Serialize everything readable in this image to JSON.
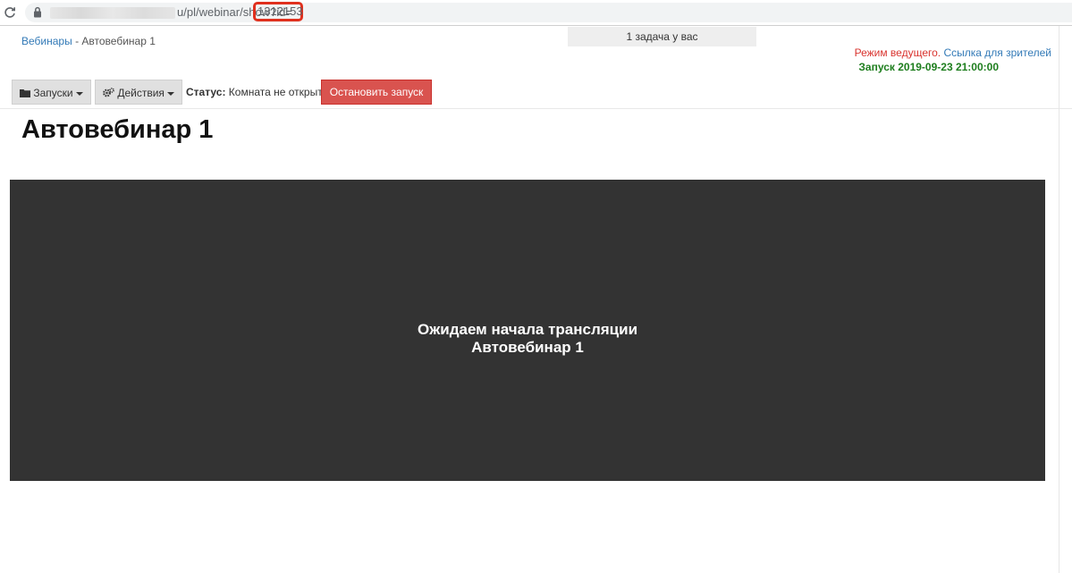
{
  "browser": {
    "url_path": "u/pl/webinar/show?id=",
    "url_id": "1312153",
    "icons": [
      "reload-icon",
      "lock-icon"
    ]
  },
  "breadcrumb": {
    "parent": "Вебинары",
    "separator": "-",
    "current": "Автовебинар 1"
  },
  "tasks": {
    "label": "1 задача у вас"
  },
  "mode": {
    "host_mode": "Режим ведущего.",
    "viewer_link": "Ссылка для зрителей",
    "launch": "Запуск 2019-09-23 21:00:00"
  },
  "toolbar": {
    "runs_label": "Запуски",
    "actions_label": "Действия",
    "status_label": "Статус:",
    "status_value": "Комната не открыта",
    "stop_label": "Остановить запуск"
  },
  "page": {
    "title": "Автовебинар 1"
  },
  "player": {
    "line1": "Ожидаем начала трансляции",
    "line2": "Автовебинар 1"
  },
  "colors": {
    "accent_blue": "#337ab7",
    "danger_red": "#d9534f",
    "launch_green": "#1e7e1e",
    "player_bg": "#333333"
  }
}
